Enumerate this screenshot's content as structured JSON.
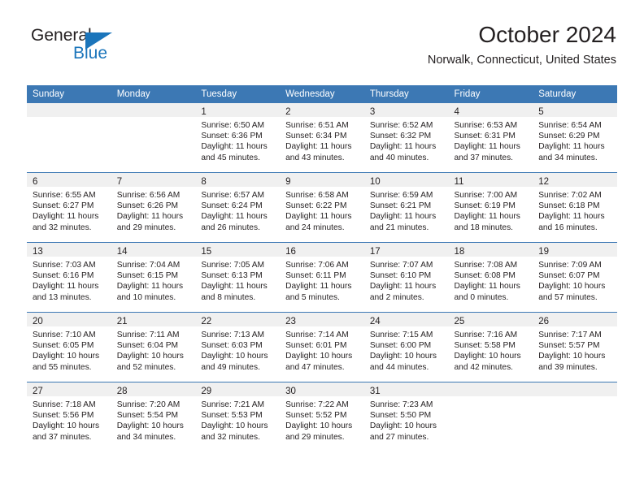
{
  "brand": {
    "name_top": "General",
    "name_bottom": "Blue",
    "accent_color": "#1b75bb"
  },
  "header": {
    "title": "October 2024",
    "subtitle": "Norwalk, Connecticut, United States",
    "header_bg": "#3c78b4",
    "band_bg": "#f0f0f0"
  },
  "weekday_headers": [
    "Sunday",
    "Monday",
    "Tuesday",
    "Wednesday",
    "Thursday",
    "Friday",
    "Saturday"
  ],
  "labels": {
    "sunrise_prefix": "Sunrise:",
    "sunset_prefix": "Sunset:",
    "daylight_prefix": "Daylight:"
  },
  "weeks": [
    [
      {
        "day": "",
        "sunrise": "",
        "sunset": "",
        "daylight_line1": "",
        "daylight_line2": ""
      },
      {
        "day": "",
        "sunrise": "",
        "sunset": "",
        "daylight_line1": "",
        "daylight_line2": ""
      },
      {
        "day": "1",
        "sunrise": "Sunrise: 6:50 AM",
        "sunset": "Sunset: 6:36 PM",
        "daylight_line1": "Daylight: 11 hours",
        "daylight_line2": "and 45 minutes."
      },
      {
        "day": "2",
        "sunrise": "Sunrise: 6:51 AM",
        "sunset": "Sunset: 6:34 PM",
        "daylight_line1": "Daylight: 11 hours",
        "daylight_line2": "and 43 minutes."
      },
      {
        "day": "3",
        "sunrise": "Sunrise: 6:52 AM",
        "sunset": "Sunset: 6:32 PM",
        "daylight_line1": "Daylight: 11 hours",
        "daylight_line2": "and 40 minutes."
      },
      {
        "day": "4",
        "sunrise": "Sunrise: 6:53 AM",
        "sunset": "Sunset: 6:31 PM",
        "daylight_line1": "Daylight: 11 hours",
        "daylight_line2": "and 37 minutes."
      },
      {
        "day": "5",
        "sunrise": "Sunrise: 6:54 AM",
        "sunset": "Sunset: 6:29 PM",
        "daylight_line1": "Daylight: 11 hours",
        "daylight_line2": "and 34 minutes."
      }
    ],
    [
      {
        "day": "6",
        "sunrise": "Sunrise: 6:55 AM",
        "sunset": "Sunset: 6:27 PM",
        "daylight_line1": "Daylight: 11 hours",
        "daylight_line2": "and 32 minutes."
      },
      {
        "day": "7",
        "sunrise": "Sunrise: 6:56 AM",
        "sunset": "Sunset: 6:26 PM",
        "daylight_line1": "Daylight: 11 hours",
        "daylight_line2": "and 29 minutes."
      },
      {
        "day": "8",
        "sunrise": "Sunrise: 6:57 AM",
        "sunset": "Sunset: 6:24 PM",
        "daylight_line1": "Daylight: 11 hours",
        "daylight_line2": "and 26 minutes."
      },
      {
        "day": "9",
        "sunrise": "Sunrise: 6:58 AM",
        "sunset": "Sunset: 6:22 PM",
        "daylight_line1": "Daylight: 11 hours",
        "daylight_line2": "and 24 minutes."
      },
      {
        "day": "10",
        "sunrise": "Sunrise: 6:59 AM",
        "sunset": "Sunset: 6:21 PM",
        "daylight_line1": "Daylight: 11 hours",
        "daylight_line2": "and 21 minutes."
      },
      {
        "day": "11",
        "sunrise": "Sunrise: 7:00 AM",
        "sunset": "Sunset: 6:19 PM",
        "daylight_line1": "Daylight: 11 hours",
        "daylight_line2": "and 18 minutes."
      },
      {
        "day": "12",
        "sunrise": "Sunrise: 7:02 AM",
        "sunset": "Sunset: 6:18 PM",
        "daylight_line1": "Daylight: 11 hours",
        "daylight_line2": "and 16 minutes."
      }
    ],
    [
      {
        "day": "13",
        "sunrise": "Sunrise: 7:03 AM",
        "sunset": "Sunset: 6:16 PM",
        "daylight_line1": "Daylight: 11 hours",
        "daylight_line2": "and 13 minutes."
      },
      {
        "day": "14",
        "sunrise": "Sunrise: 7:04 AM",
        "sunset": "Sunset: 6:15 PM",
        "daylight_line1": "Daylight: 11 hours",
        "daylight_line2": "and 10 minutes."
      },
      {
        "day": "15",
        "sunrise": "Sunrise: 7:05 AM",
        "sunset": "Sunset: 6:13 PM",
        "daylight_line1": "Daylight: 11 hours",
        "daylight_line2": "and 8 minutes."
      },
      {
        "day": "16",
        "sunrise": "Sunrise: 7:06 AM",
        "sunset": "Sunset: 6:11 PM",
        "daylight_line1": "Daylight: 11 hours",
        "daylight_line2": "and 5 minutes."
      },
      {
        "day": "17",
        "sunrise": "Sunrise: 7:07 AM",
        "sunset": "Sunset: 6:10 PM",
        "daylight_line1": "Daylight: 11 hours",
        "daylight_line2": "and 2 minutes."
      },
      {
        "day": "18",
        "sunrise": "Sunrise: 7:08 AM",
        "sunset": "Sunset: 6:08 PM",
        "daylight_line1": "Daylight: 11 hours",
        "daylight_line2": "and 0 minutes."
      },
      {
        "day": "19",
        "sunrise": "Sunrise: 7:09 AM",
        "sunset": "Sunset: 6:07 PM",
        "daylight_line1": "Daylight: 10 hours",
        "daylight_line2": "and 57 minutes."
      }
    ],
    [
      {
        "day": "20",
        "sunrise": "Sunrise: 7:10 AM",
        "sunset": "Sunset: 6:05 PM",
        "daylight_line1": "Daylight: 10 hours",
        "daylight_line2": "and 55 minutes."
      },
      {
        "day": "21",
        "sunrise": "Sunrise: 7:11 AM",
        "sunset": "Sunset: 6:04 PM",
        "daylight_line1": "Daylight: 10 hours",
        "daylight_line2": "and 52 minutes."
      },
      {
        "day": "22",
        "sunrise": "Sunrise: 7:13 AM",
        "sunset": "Sunset: 6:03 PM",
        "daylight_line1": "Daylight: 10 hours",
        "daylight_line2": "and 49 minutes."
      },
      {
        "day": "23",
        "sunrise": "Sunrise: 7:14 AM",
        "sunset": "Sunset: 6:01 PM",
        "daylight_line1": "Daylight: 10 hours",
        "daylight_line2": "and 47 minutes."
      },
      {
        "day": "24",
        "sunrise": "Sunrise: 7:15 AM",
        "sunset": "Sunset: 6:00 PM",
        "daylight_line1": "Daylight: 10 hours",
        "daylight_line2": "and 44 minutes."
      },
      {
        "day": "25",
        "sunrise": "Sunrise: 7:16 AM",
        "sunset": "Sunset: 5:58 PM",
        "daylight_line1": "Daylight: 10 hours",
        "daylight_line2": "and 42 minutes."
      },
      {
        "day": "26",
        "sunrise": "Sunrise: 7:17 AM",
        "sunset": "Sunset: 5:57 PM",
        "daylight_line1": "Daylight: 10 hours",
        "daylight_line2": "and 39 minutes."
      }
    ],
    [
      {
        "day": "27",
        "sunrise": "Sunrise: 7:18 AM",
        "sunset": "Sunset: 5:56 PM",
        "daylight_line1": "Daylight: 10 hours",
        "daylight_line2": "and 37 minutes."
      },
      {
        "day": "28",
        "sunrise": "Sunrise: 7:20 AM",
        "sunset": "Sunset: 5:54 PM",
        "daylight_line1": "Daylight: 10 hours",
        "daylight_line2": "and 34 minutes."
      },
      {
        "day": "29",
        "sunrise": "Sunrise: 7:21 AM",
        "sunset": "Sunset: 5:53 PM",
        "daylight_line1": "Daylight: 10 hours",
        "daylight_line2": "and 32 minutes."
      },
      {
        "day": "30",
        "sunrise": "Sunrise: 7:22 AM",
        "sunset": "Sunset: 5:52 PM",
        "daylight_line1": "Daylight: 10 hours",
        "daylight_line2": "and 29 minutes."
      },
      {
        "day": "31",
        "sunrise": "Sunrise: 7:23 AM",
        "sunset": "Sunset: 5:50 PM",
        "daylight_line1": "Daylight: 10 hours",
        "daylight_line2": "and 27 minutes."
      },
      {
        "day": "",
        "sunrise": "",
        "sunset": "",
        "daylight_line1": "",
        "daylight_line2": ""
      },
      {
        "day": "",
        "sunrise": "",
        "sunset": "",
        "daylight_line1": "",
        "daylight_line2": ""
      }
    ]
  ]
}
